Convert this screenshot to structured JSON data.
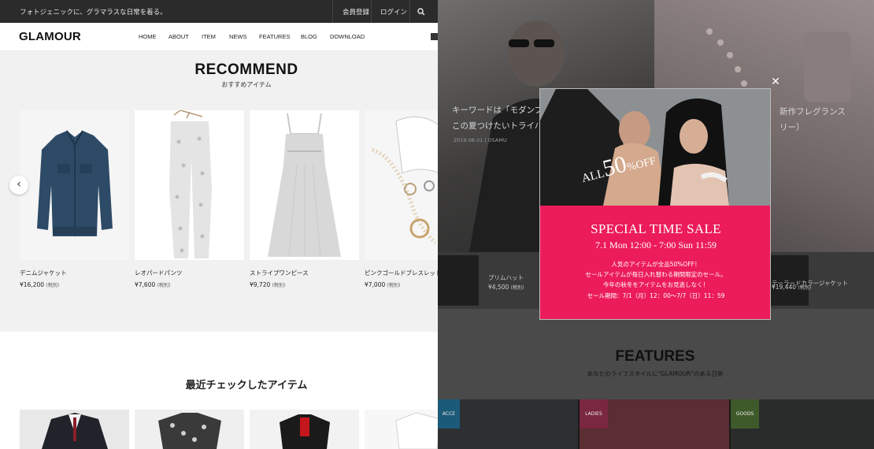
{
  "topbar": {
    "tagline": "フォトジェニックに、グラマラスな日常を着る。",
    "register": "会員登録",
    "login": "ログイン",
    "search_icon": "search-icon"
  },
  "header": {
    "logo": "GLAMOUR",
    "nav": [
      "HOME",
      "ABOUT",
      "ITEM",
      "NEWS",
      "FEATURES",
      "BLOG",
      "DOWNLOAD"
    ],
    "social_icon": "facebook-icon"
  },
  "recommend": {
    "title": "RECOMMEND",
    "subtitle": "おすすめアイテム",
    "prev_icon": "chevron-left-icon",
    "items": [
      {
        "name": "デニムジャケット",
        "price": "¥16,200",
        "tax": "(税別)"
      },
      {
        "name": "レオパードパンツ",
        "price": "¥7,600",
        "tax": "(税別)"
      },
      {
        "name": "ストライプワンピース",
        "price": "¥9,720",
        "tax": "(税別)"
      },
      {
        "name": "ピンクゴールドブレスレット",
        "price": "¥7,000",
        "tax": "(税別)"
      }
    ]
  },
  "recent": {
    "title": "最近チェックしたアイテム"
  },
  "background_page": {
    "hero_left_lines": [
      "キーワードは「モダンプ",
      "この夏つけたいトライバ"
    ],
    "hero_left_meta": "2019.08.01 | OSAMU",
    "hero_right_lines": [
      "新作フレグランス",
      "リー）"
    ],
    "items": [
      {
        "name": "プリムハット",
        "price": "¥4,500",
        "tax": "(税別)"
      },
      {
        "name": "テーラードカラージャケット",
        "price": "¥19,440",
        "tax": "(税別)"
      }
    ],
    "features_title": "FEATURES",
    "features_subtitle": "あなたのライフスタイルに\"GLAMOUR\"のある日常",
    "feature_tags": [
      "ACCE",
      "LADIES",
      "GOODS"
    ]
  },
  "modal": {
    "close_icon": "close-icon",
    "promo_a": "ALL",
    "promo_b": "50",
    "promo_c": "%OFF",
    "sale_title": "SPECIAL TIME SALE",
    "sale_dates": "7.1 Mon 12:00 - 7:00 Sun 11:59",
    "lines": [
      "人気のアイテムが全品50%OFF！",
      "セールアイテムが毎日入れ替わる期間限定のセール。",
      "今年の秋冬をアイテムをお見逃しなく！",
      "セール期間：7/1（月）12：00〜7/7（日）11：59"
    ],
    "accent_color": "#ec1c5b"
  }
}
